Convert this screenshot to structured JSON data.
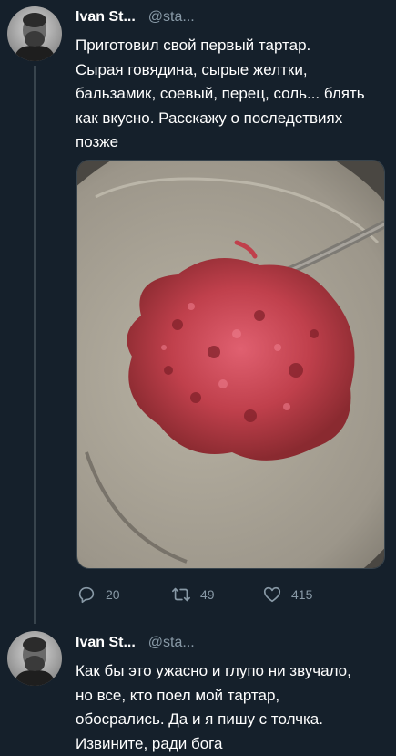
{
  "tweets": [
    {
      "name": "Ivan St...",
      "handle": "@sta...",
      "text": "Приготовил свой первый тартар.\nСырая говядина, сырые желтки,\nбальзамик, соевый, перец, соль... блять\nкак вкусно. Расскажу о последствиях\nпозже",
      "actions": {
        "replies": "20",
        "retweets": "49",
        "likes": "415"
      }
    },
    {
      "name": "Ivan St...",
      "handle": "@sta...",
      "text": "Как бы это ужасно и глупо ни звучало,\nно все, кто поел мой тартар,\nобосрались. Да и я пишу с толчка.\nИзвините, ради бога"
    }
  ],
  "icons": {
    "reply": "reply-icon",
    "retweet": "retweet-icon",
    "like": "heart-icon"
  },
  "colors": {
    "background": "#15202b",
    "secondary_text": "#8899a6",
    "thread_line": "#38444d"
  }
}
